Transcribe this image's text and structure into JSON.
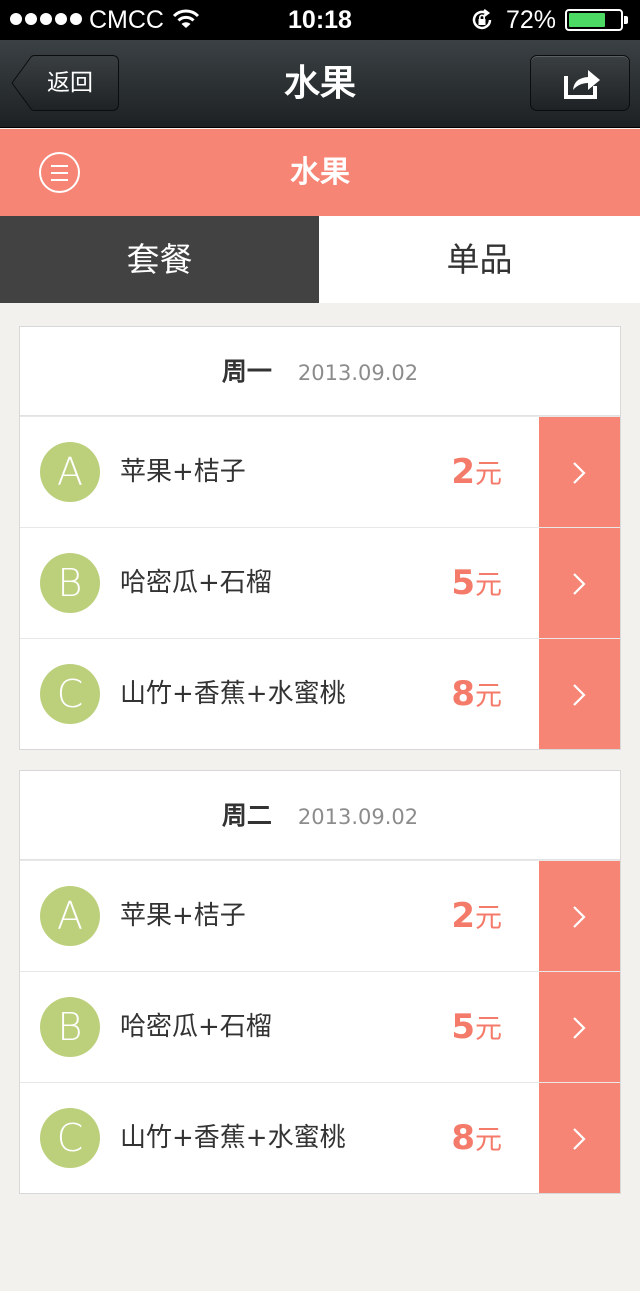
{
  "status_bar": {
    "carrier": "CMCC",
    "time": "10:18",
    "battery_percent": "72%",
    "battery_level": 0.72,
    "battery_color": "#4cd964"
  },
  "nav_bar": {
    "back_label": "返回",
    "title": "水果",
    "share_icon": "share-icon"
  },
  "sub_header": {
    "menu_icon": "menu-icon",
    "title": "水果",
    "color": "#f78576"
  },
  "tabs": [
    {
      "label": "套餐",
      "active": true
    },
    {
      "label": "单品",
      "active": false
    }
  ],
  "days": [
    {
      "name": "周一",
      "date": "2013.09.02",
      "items": [
        {
          "letter": "A",
          "name": "苹果+桔子",
          "price": "2",
          "unit": "元"
        },
        {
          "letter": "B",
          "name": "哈密瓜+石榴",
          "price": "5",
          "unit": "元"
        },
        {
          "letter": "C",
          "name": "山竹+香蕉+水蜜桃",
          "price": "8",
          "unit": "元"
        }
      ]
    },
    {
      "name": "周二",
      "date": "2013.09.02",
      "items": [
        {
          "letter": "A",
          "name": "苹果+桔子",
          "price": "2",
          "unit": "元"
        },
        {
          "letter": "B",
          "name": "哈密瓜+石榴",
          "price": "5",
          "unit": "元"
        },
        {
          "letter": "C",
          "name": "山竹+香蕉+水蜜桃",
          "price": "8",
          "unit": "元"
        }
      ]
    }
  ],
  "colors": {
    "accent": "#f78576",
    "price": "#f47a69",
    "badge": "#bcd07c",
    "active_tab": "#424242"
  }
}
